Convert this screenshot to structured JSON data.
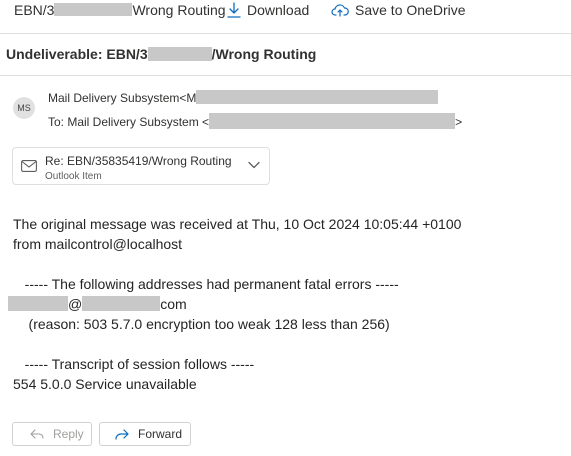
{
  "toolbar": {
    "title_prefix": "EBN/3",
    "title_suffix": "Wrong Routing",
    "download_label": "Download",
    "onedrive_label": "Save to OneDrive"
  },
  "subject": {
    "prefix": "Undeliverable: EBN/3",
    "suffix": "/Wrong Routing"
  },
  "sender": {
    "initials": "MS",
    "from": "Mail Delivery Subsystem<M",
    "to_prefix": "To:  Mail Delivery Subsystem <",
    "to_suffix": ">"
  },
  "attachment": {
    "name": "Re: EBN/35835419/Wrong Routing",
    "type": "Outlook Item"
  },
  "body": {
    "line1": "The original message was received at Thu, 10 Oct 2024 10:05:44 +0100",
    "line2": "from mailcontrol@localhost",
    "line3": "   ----- The following addresses had permanent fatal errors -----",
    "line4_mid": "@",
    "line4_end": "com",
    "line5": "    (reason: 503 5.7.0 encryption too weak 128 less than 256)",
    "line6": "   ----- Transcript of session follows -----",
    "line7": "554 5.0.0 Service unavailable"
  },
  "actions": {
    "reply_label": "Reply",
    "forward_label": "Forward"
  }
}
